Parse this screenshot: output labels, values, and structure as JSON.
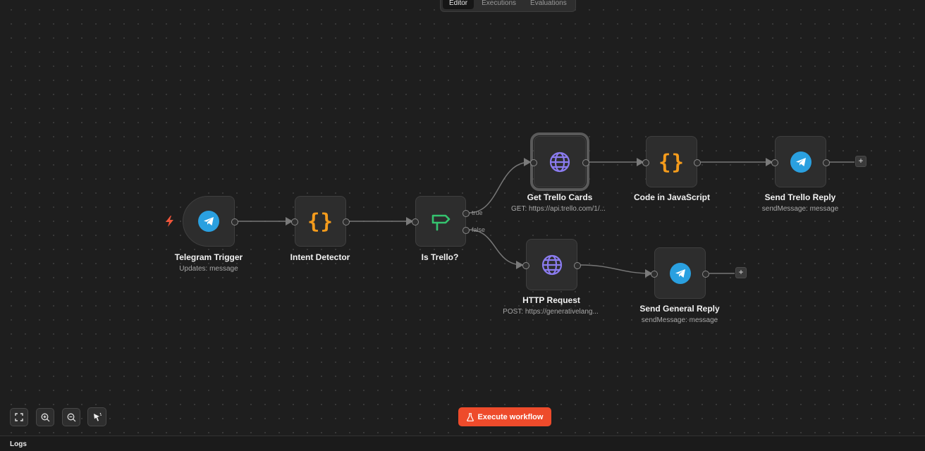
{
  "mode_tabs": [
    "Editor",
    "Executions",
    "Evaluations"
  ],
  "nodes": {
    "telegram_trigger": {
      "label": "Telegram Trigger",
      "subtitle": "Updates: message",
      "icon": "telegram-icon"
    },
    "intent_detector": {
      "label": "Intent Detector",
      "icon": "code-braces-icon"
    },
    "is_trello": {
      "label": "Is Trello?",
      "icon": "signpost-icon",
      "branches": [
        "true",
        "false"
      ]
    },
    "get_trello_cards": {
      "label": "Get Trello Cards",
      "subtitle": "GET: https://api.trello.com/1/...",
      "icon": "globe-icon"
    },
    "code_in_javascript": {
      "label": "Code in JavaScript",
      "icon": "code-braces-icon"
    },
    "send_trello_reply": {
      "label": "Send Trello Reply",
      "subtitle": "sendMessage: message",
      "icon": "telegram-icon"
    },
    "http_request": {
      "label": "HTTP Request",
      "subtitle": "POST: https://generativelang...",
      "icon": "globe-icon"
    },
    "send_general_reply": {
      "label": "Send General Reply",
      "subtitle": "sendMessage: message",
      "icon": "telegram-icon"
    }
  },
  "add_node_symbol": "+",
  "controls": [
    "fit-view-icon",
    "zoom-in-icon",
    "zoom-out-icon",
    "tidy-up-icon"
  ],
  "execute_button": {
    "label": "Execute workflow",
    "icon": "flask-icon"
  },
  "logs": {
    "label": "Logs"
  },
  "colors": {
    "background": "#1e1e1e",
    "node": "#2d2d2d",
    "telegram": "#2aa0e0",
    "code": "#f59c1c",
    "globe": "#8b7cf0",
    "if": "#35c46f",
    "execute": "#ee4b2b",
    "trigger_bolt": "#f0553a"
  }
}
